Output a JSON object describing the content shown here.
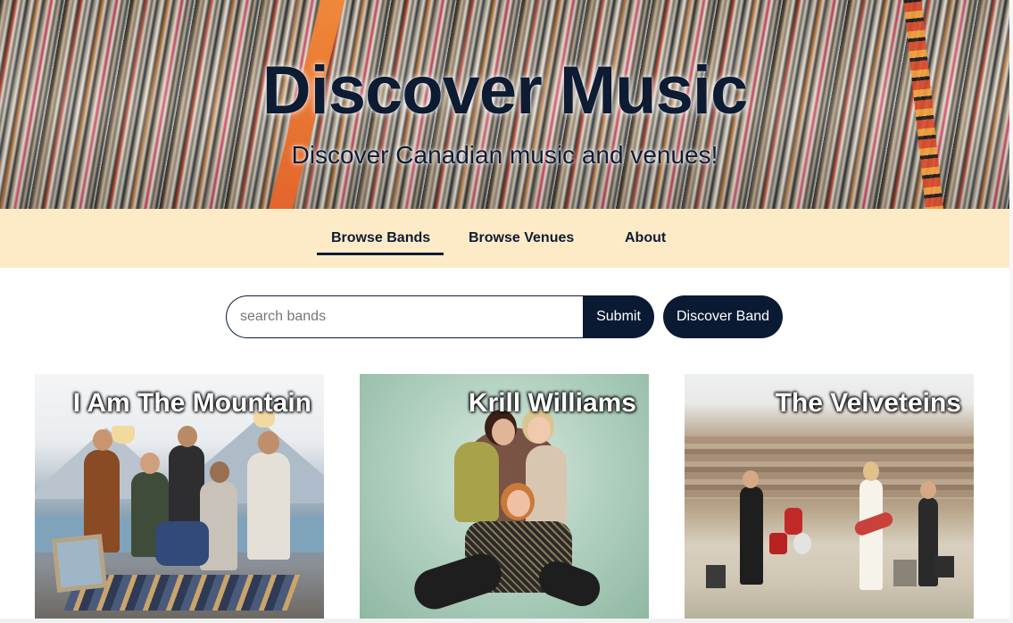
{
  "hero": {
    "title": "Discover Music",
    "subtitle": "Discover Canadian music and venues!"
  },
  "nav": {
    "items": [
      {
        "label": "Browse Bands",
        "active": true
      },
      {
        "label": "Browse Venues",
        "active": false
      },
      {
        "label": "About",
        "active": false
      }
    ]
  },
  "search": {
    "placeholder": "search bands",
    "value": "",
    "submit_label": "Submit",
    "discover_label": "Discover Band"
  },
  "bands": [
    {
      "name": "I Am The Mountain"
    },
    {
      "name": "Krill Williams"
    },
    {
      "name": "The Velveteins"
    }
  ],
  "colors": {
    "navy": "#0b1a33",
    "nav_background": "#fdebc8",
    "accent_orange": "#e2622a"
  }
}
